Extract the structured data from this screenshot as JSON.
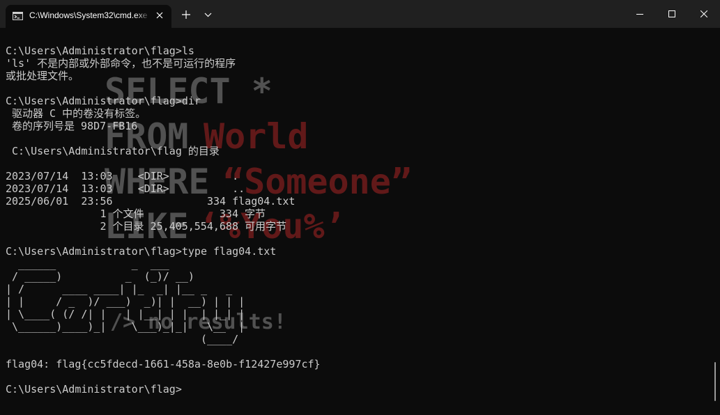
{
  "window": {
    "tab_title": "C:\\Windows\\System32\\cmd.exe"
  },
  "background": {
    "line1": "SELECT *",
    "line2_a": "FROM ",
    "line2_b": "World",
    "line3_a": "WHERE ",
    "line3_b": "“Someone”",
    "line4_a": "LIKE ",
    "line4_b": "‘%You%’",
    "line5": "/> no results!",
    "gray_color": "#8a8a8a",
    "red_color": "#a82424"
  },
  "terminal": {
    "output": "C:\\Users\\Administrator\\flag>ls\n'ls' 不是内部或外部命令，也不是可运行的程序\n或批处理文件。\n\nC:\\Users\\Administrator\\flag>dir\n 驱动器 C 中的卷没有标签。\n 卷的序列号是 98D7-FB16\n\n C:\\Users\\Administrator\\flag 的目录\n\n2023/07/14  13:03    <DIR>          .\n2023/07/14  13:03    <DIR>          ..\n2025/06/01  23:56               334 flag04.txt\n               1 个文件            334 字节\n               2 个目录 25,405,554,688 可用字节\n\nC:\\Users\\Administrator\\flag>type flag04.txt\n  ______            _  ___\n / _____)          _  (_)/ __)\n| /      ____ ____| |_  _| |__ _   _\n| |     / _  )/ ___)  _)| |  __) | | |\n| \\____( (/ /| |   | |__| | |  | |_| |\n \\______)____)_|    \\___)_|_|   \\__  |\n                               (____/\n\nflag04: flag{cc5fdecd-1661-458a-8e0b-f12427e997cf}\n\nC:\\Users\\Administrator\\flag>"
  }
}
